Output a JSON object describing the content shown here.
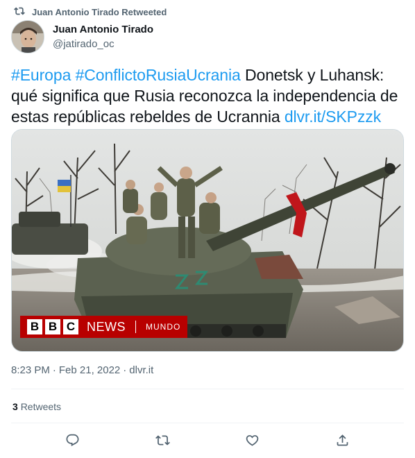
{
  "retweet_banner": {
    "text": "Juan Antonio Tirado Retweeted",
    "icon": "retweet-icon"
  },
  "author": {
    "name": "Juan Antonio Tirado",
    "handle": "@jatirado_oc",
    "avatar_icon": "avatar"
  },
  "tweet": {
    "hashtag_1": "#Europa",
    "hashtag_2": "#ConflictoRusiaUcrania",
    "body": "Donetsk y Luhansk: qué significa que Rusia reconozca la independencia de estas repúblicas rebeldes de Ucrannia",
    "link": "dlvr.it/SKPzzk"
  },
  "media": {
    "badge_letters": [
      "B",
      "B",
      "C"
    ],
    "badge_news": "NEWS",
    "badge_section": "MUNDO"
  },
  "meta": {
    "time": "8:23 PM",
    "sep1": "·",
    "date": "Feb 21, 2022",
    "sep2": "·",
    "source": "dlvr.it"
  },
  "stats": {
    "retweets_count": "3",
    "retweets_label": "Retweets"
  },
  "actions": [
    "reply-icon",
    "retweet-icon",
    "like-icon",
    "share-icon"
  ],
  "colors": {
    "link": "#1d9bf0",
    "secondary_text": "#536471",
    "bbc_red": "#b80000"
  }
}
